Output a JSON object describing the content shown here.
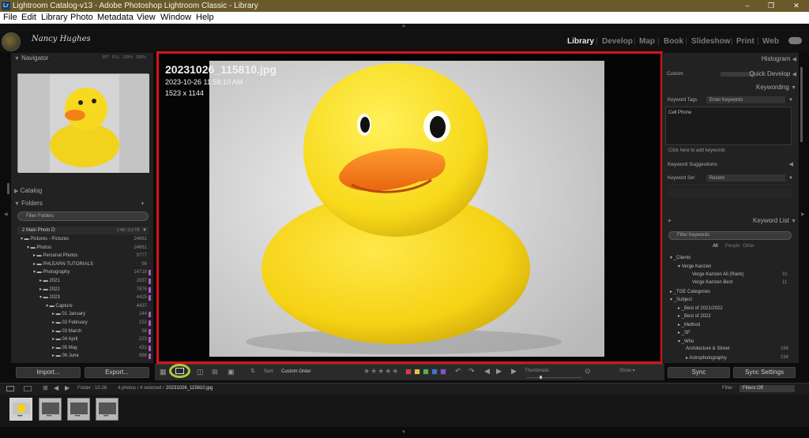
{
  "window": {
    "title": "Lightroom Catalog-v13 - Adobe Photoshop Lightroom Classic - Library",
    "minimize": "–",
    "maximize": "❐",
    "close": "✕"
  },
  "menu": [
    "File",
    "Edit",
    "Library",
    "Photo",
    "Metadata",
    "View",
    "Window",
    "Help"
  ],
  "identity": {
    "signature": "Nancy Hughes"
  },
  "modules": [
    {
      "label": "Library",
      "active": true
    },
    {
      "label": "Develop"
    },
    {
      "label": "Map"
    },
    {
      "label": "Book"
    },
    {
      "label": "Slideshow"
    },
    {
      "label": "Print"
    },
    {
      "label": "Web"
    }
  ],
  "left": {
    "navigator": {
      "title": "Navigator",
      "zoom": [
        "FIT",
        "FILL",
        "100%",
        "300%"
      ]
    },
    "catalog": {
      "title": "Catalog"
    },
    "folders": {
      "title": "Folders",
      "filter_placeholder": "Filter Folders",
      "volume": {
        "name": "2 Main Photo D:",
        "space": "1.48 / 3.6 TB"
      },
      "rows": [
        {
          "label": "Pictures - Pictures",
          "count": "24661",
          "indent": 1
        },
        {
          "label": "Photos",
          "count": "24661",
          "indent": 2
        },
        {
          "label": "Personal Photos",
          "count": "9777",
          "indent": 3
        },
        {
          "label": "PHLEARN TUTORIALS",
          "count": "56",
          "indent": 3
        },
        {
          "label": "Photography",
          "count": "14718",
          "indent": 3
        },
        {
          "label": "2021",
          "count": "2837",
          "indent": 4
        },
        {
          "label": "2022",
          "count": "7676",
          "indent": 4
        },
        {
          "label": "2023",
          "count": "4425",
          "indent": 4
        },
        {
          "label": "Capture",
          "count": "4437",
          "indent": 5
        },
        {
          "label": "01 January",
          "count": "144",
          "indent": 6
        },
        {
          "label": "02 February",
          "count": "152",
          "indent": 6
        },
        {
          "label": "03 March",
          "count": "58",
          "indent": 6
        },
        {
          "label": "04 April",
          "count": "223",
          "indent": 6
        },
        {
          "label": "05 May",
          "count": "431",
          "indent": 6
        },
        {
          "label": "06 June",
          "count": "988",
          "indent": 6
        }
      ]
    },
    "import_label": "Import...",
    "export_label": "Export..."
  },
  "main": {
    "filename": "20231026_115810.jpg",
    "datetime": "2023-10-26 11:58:10 AM",
    "dimensions": "1523 x 1144"
  },
  "toolbar": {
    "sort_label": "Sort:",
    "sort_value": "Custom Order",
    "thumbnails_label": "Thumbnails",
    "swatch_colors": [
      "#d93c3c",
      "#e3c43a",
      "#4fb34f",
      "#3f6fd8",
      "#8a4fc9"
    ],
    "show_label": "Show"
  },
  "right": {
    "histogram": {
      "title": "Histogram"
    },
    "quick_develop": {
      "title": "Quick Develop",
      "preset": "Custom"
    },
    "keywording": {
      "title": "Keywording",
      "tags_label": "Keyword Tags",
      "tags_placeholder": "Enter Keywords",
      "current": "Cell Phone",
      "click_hint": "Click here to add keywords",
      "suggestions_title": "Keyword Suggestions",
      "set_label": "Keyword Set",
      "set_value": "Recent"
    },
    "keyword_list": {
      "title": "Keyword List",
      "filter_placeholder": "Filter Keywords",
      "tabs": [
        "All",
        "People",
        "Other"
      ],
      "items": [
        {
          "label": "_Clients",
          "count": ""
        },
        {
          "label": "Verge Kanzen",
          "count": ""
        },
        {
          "label": "Verge Kanzen All (Rank)",
          "count": "31"
        },
        {
          "label": "Verge Kanzen Best",
          "count": "11"
        },
        {
          "label": "_TGE Categories",
          "count": ""
        },
        {
          "label": "_Subject",
          "count": ""
        },
        {
          "label": "_Best of 2021/2022",
          "count": ""
        },
        {
          "label": "_Best of 2022",
          "count": ""
        },
        {
          "label": "_Method",
          "count": ""
        },
        {
          "label": "_SF",
          "count": ""
        },
        {
          "label": "_Who",
          "count": ""
        },
        {
          "label": "Architecture & Street",
          "count": "166"
        },
        {
          "label": "Astrophotography",
          "count": "194"
        }
      ]
    },
    "sync_label": "Sync",
    "sync_settings_label": "Sync Settings"
  },
  "filmstrip": {
    "source": "Folder : 10-26",
    "status": "4 photos / 4 selected /",
    "selected_file": "20231026_115810.jpg",
    "filter_label": "Filter :",
    "filter_value": "Filters Off",
    "thumbs": [
      {
        "selected": true
      },
      {
        "selected": false
      },
      {
        "selected": false
      },
      {
        "selected": false
      }
    ]
  }
}
